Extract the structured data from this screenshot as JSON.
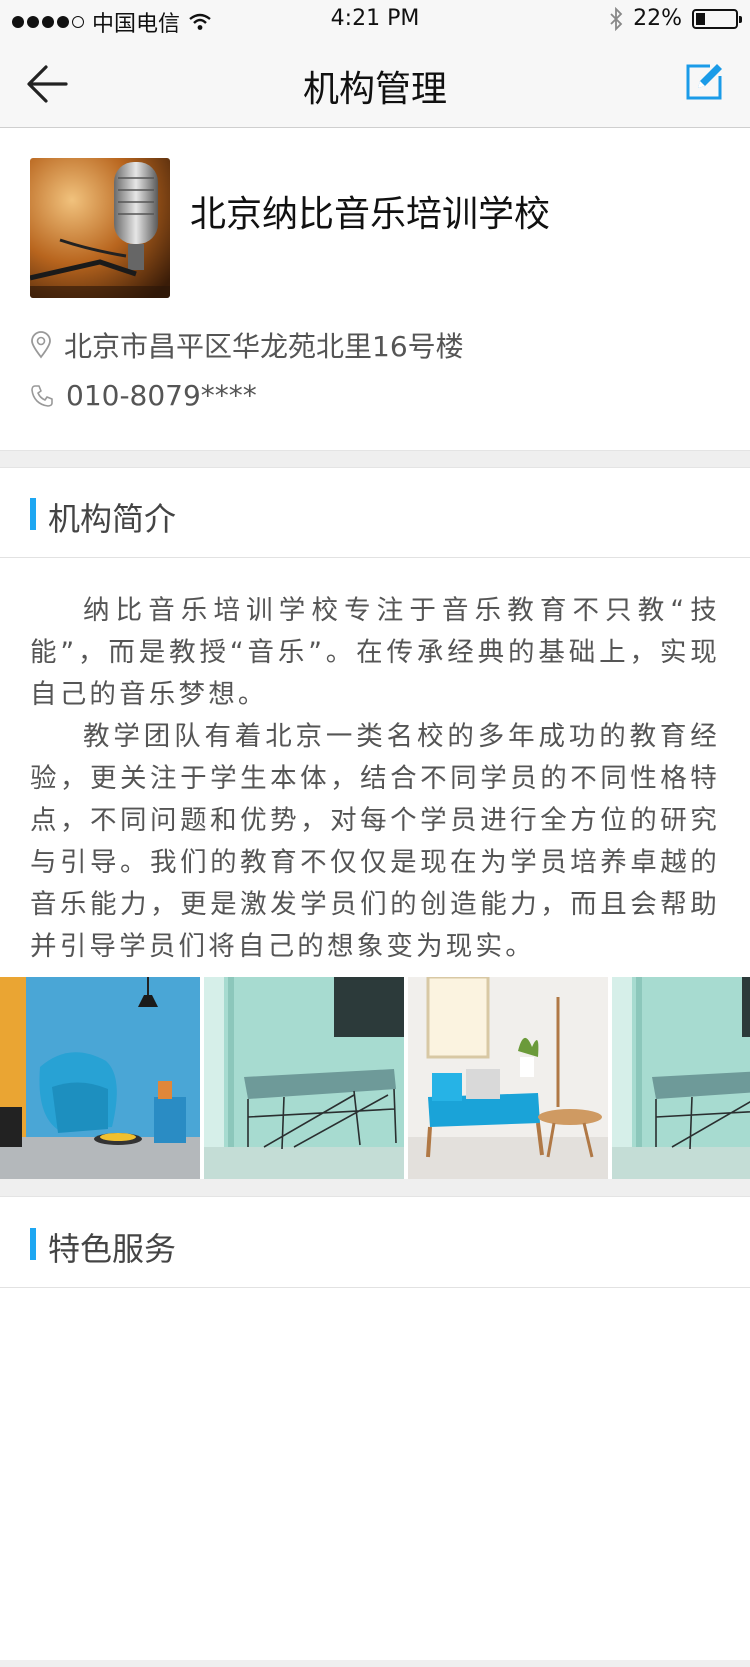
{
  "status": {
    "carrier": "中国电信",
    "time": "4:21 PM",
    "battery": "22%"
  },
  "nav": {
    "title": "机构管理"
  },
  "org": {
    "name": "北京纳比音乐培训学校",
    "address": "北京市昌平区华龙苑北里16号楼",
    "phone": "010-8079****"
  },
  "intro": {
    "title": "机构简介",
    "paragraphs": [
      "纳比音乐培训学校专注于音乐教育不只教“技能”，而是教授“音乐”。在传承经典的基础上，实现自己的音乐梦想。",
      "教学团队有着北京一类名校的多年成功的教育经验，更关注于学生本体，结合不同学员的不同性格特点，不同问题和优势，对每个学员进行全方位的研究与引导。我们的教育不仅仅是现在为学员培养卓越的音乐能力，更是激发学员们的创造能力，而且会帮助并引导学员们将自己的想象变为现实。"
    ]
  },
  "services": {
    "title": "特色服务"
  },
  "colors": {
    "accent": "#1ea7f2",
    "edit_icon": "#1a9be8"
  }
}
